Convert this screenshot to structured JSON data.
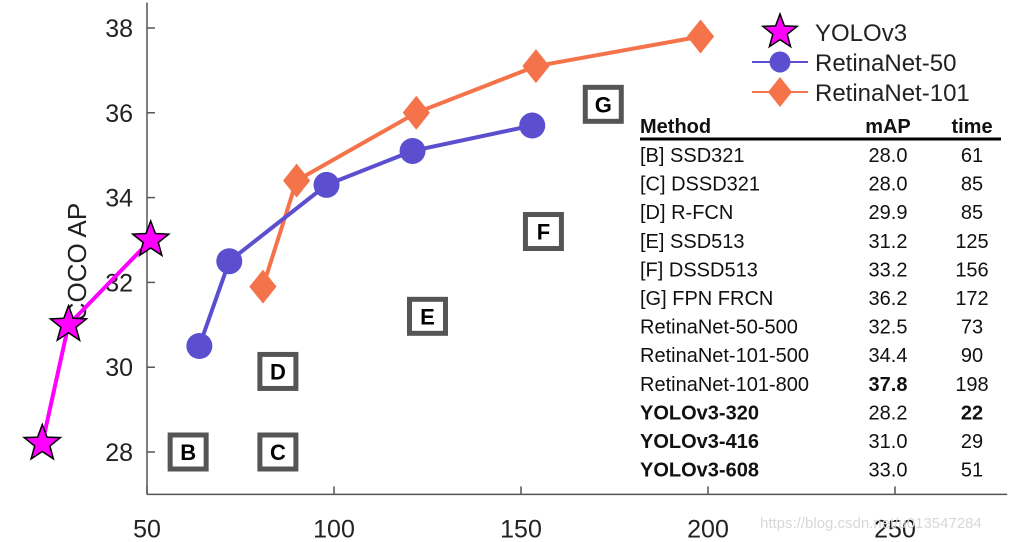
{
  "chart_data": {
    "type": "line",
    "xlabel": "",
    "ylabel": "COCO AP",
    "xlim": [
      50,
      280
    ],
    "ylim": [
      27,
      38.6
    ],
    "xticks": [
      50,
      100,
      150,
      200,
      250
    ],
    "yticks": [
      28,
      30,
      32,
      34,
      36,
      38
    ],
    "grid": false,
    "legend_position": "top-right",
    "series": [
      {
        "name": "YOLOv3",
        "color": "#ff00ff",
        "marker": "star",
        "x": [
          22,
          29,
          51
        ],
        "y": [
          28.2,
          31.0,
          33.0
        ]
      },
      {
        "name": "RetinaNet-50",
        "color": "#5b4fcf",
        "marker": "circle",
        "x": [
          64,
          72,
          98,
          121,
          153
        ],
        "y": [
          30.5,
          32.5,
          34.3,
          35.1,
          35.7
        ]
      },
      {
        "name": "RetinaNet-101",
        "color": "#f5734a",
        "marker": "diamond",
        "x": [
          81,
          90,
          122,
          154,
          198
        ],
        "y": [
          31.9,
          34.4,
          36.0,
          37.1,
          37.8
        ]
      }
    ],
    "box_markers": [
      {
        "label": "B",
        "x": 61,
        "y": 28.0
      },
      {
        "label": "C",
        "x": 85,
        "y": 28.0
      },
      {
        "label": "D",
        "x": 85,
        "y": 29.9
      },
      {
        "label": "E",
        "x": 125,
        "y": 31.2
      },
      {
        "label": "F",
        "x": 156,
        "y": 33.2
      },
      {
        "label": "G",
        "x": 172,
        "y": 36.2
      }
    ],
    "table": {
      "headers": [
        "Method",
        "mAP",
        "time"
      ],
      "rows": [
        {
          "method": "[B] SSD321",
          "map": "28.0",
          "time": "61",
          "bold": []
        },
        {
          "method": "[C] DSSD321",
          "map": "28.0",
          "time": "85",
          "bold": []
        },
        {
          "method": "[D] R-FCN",
          "map": "29.9",
          "time": "85",
          "bold": []
        },
        {
          "method": "[E] SSD513",
          "map": "31.2",
          "time": "125",
          "bold": []
        },
        {
          "method": "[F] DSSD513",
          "map": "33.2",
          "time": "156",
          "bold": []
        },
        {
          "method": "[G] FPN FRCN",
          "map": "36.2",
          "time": "172",
          "bold": []
        },
        {
          "method": "RetinaNet-50-500",
          "map": "32.5",
          "time": "73",
          "bold": []
        },
        {
          "method": "RetinaNet-101-500",
          "map": "34.4",
          "time": "90",
          "bold": []
        },
        {
          "method": "RetinaNet-101-800",
          "map": "37.8",
          "time": "198",
          "bold": [
            "map"
          ]
        },
        {
          "method": "YOLOv3-320",
          "map": "28.2",
          "time": "22",
          "bold": [
            "method",
            "time"
          ]
        },
        {
          "method": "YOLOv3-416",
          "map": "31.0",
          "time": "29",
          "bold": [
            "method"
          ]
        },
        {
          "method": "YOLOv3-608",
          "map": "33.0",
          "time": "51",
          "bold": [
            "method"
          ]
        }
      ]
    }
  },
  "watermark": "https://blog.csdn.net/u013547284"
}
